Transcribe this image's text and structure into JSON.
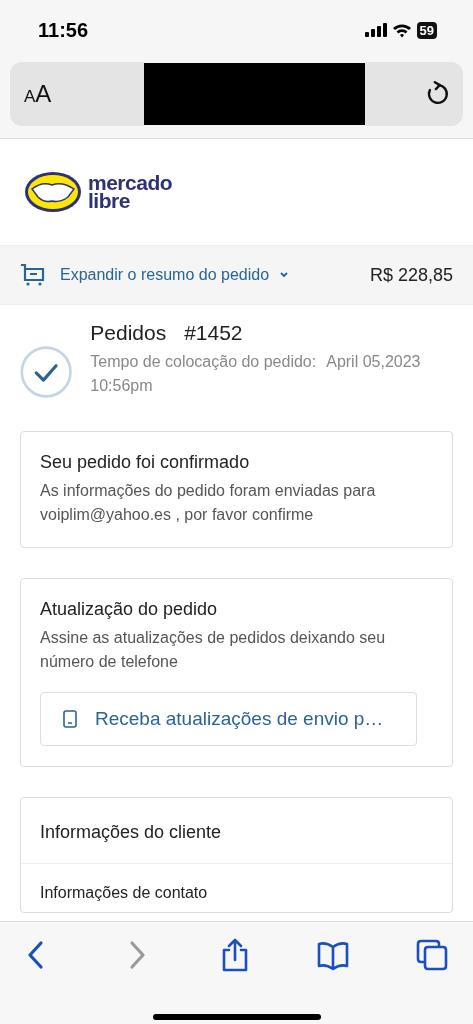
{
  "status_bar": {
    "time": "11:56",
    "battery": "59"
  },
  "browser_bar": {
    "text_size_label": "AA"
  },
  "logo": {
    "line_1": "mercado",
    "line_2": "libre"
  },
  "order_summary": {
    "label": "Expandir o resumo do pedido",
    "expanded": false,
    "total": "R$ 228,85"
  },
  "order": {
    "title": "Pedidos",
    "number": "#1452",
    "placed_label": "Tempo de colocação do pedido:",
    "placed_date": "April 05,2023",
    "placed_time": "10:56pm",
    "confirmed": true
  },
  "confirmation_card": {
    "title": "Seu pedido foi confirmado",
    "text": "As informações do pedido foram enviadas para voiplim@yahoo.es , por favor confirme"
  },
  "updates_card": {
    "title": "Atualização do pedido",
    "text": "Assine as atualizações de pedidos deixando seu número de telefone",
    "phone_button": "Receba atualizações de envio p…"
  },
  "customer_card": {
    "title": "Informações do cliente",
    "section": "Informações de contato"
  },
  "toolbar": [
    {
      "kind": "back",
      "disabled": false
    },
    {
      "kind": "forward",
      "disabled": true
    },
    {
      "kind": "share",
      "disabled": false
    },
    {
      "kind": "bookmarks",
      "disabled": false
    },
    {
      "kind": "tabs",
      "disabled": false
    }
  ]
}
